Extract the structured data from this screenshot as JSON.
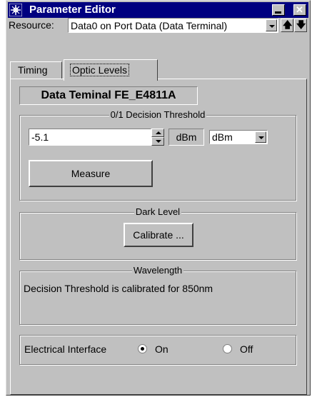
{
  "window": {
    "title": "Parameter Editor",
    "minimize_icon": "minimize-icon",
    "close_glyph": "✕"
  },
  "resource": {
    "label": "Resource:",
    "value": "Data0 on Port Data (Data Terminal)",
    "up_glyph": "🡅",
    "down_glyph": "🡇"
  },
  "tabs": [
    {
      "label": "Timing",
      "active": false
    },
    {
      "label": "Optic Levels",
      "active": true
    }
  ],
  "panel": {
    "header": "Data Teminal FE_E4811A",
    "threshold": {
      "title": "0/1 Decision Threshold",
      "value": "-5.1",
      "unit_label": "dBm",
      "unit_select": "dBm",
      "measure_label": "Measure"
    },
    "dark_level": {
      "title": "Dark Level",
      "calibrate_label": "Calibrate ..."
    },
    "wavelength": {
      "title": "Wavelength",
      "text": "Decision Threshold is calibrated for 850nm"
    },
    "electrical": {
      "label": "Electrical Interface",
      "on_label": "On",
      "off_label": "Off",
      "selected": "On"
    }
  }
}
